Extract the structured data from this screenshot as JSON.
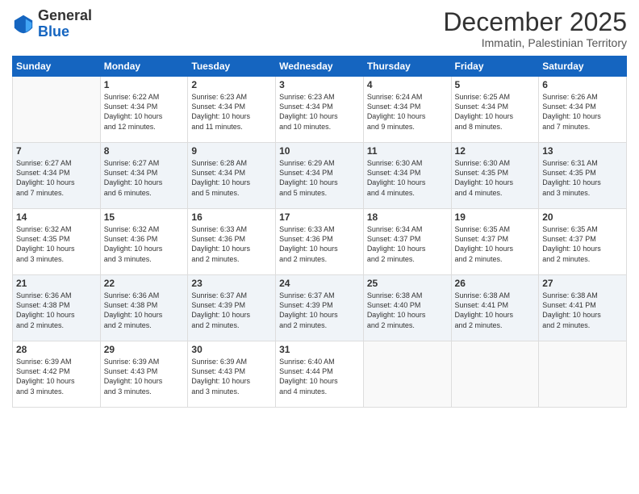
{
  "logo": {
    "general": "General",
    "blue": "Blue"
  },
  "header": {
    "month": "December 2025",
    "location": "Immatin, Palestinian Territory"
  },
  "days_of_week": [
    "Sunday",
    "Monday",
    "Tuesday",
    "Wednesday",
    "Thursday",
    "Friday",
    "Saturday"
  ],
  "weeks": [
    [
      {
        "day": "",
        "info": ""
      },
      {
        "day": "1",
        "info": "Sunrise: 6:22 AM\nSunset: 4:34 PM\nDaylight: 10 hours\nand 12 minutes."
      },
      {
        "day": "2",
        "info": "Sunrise: 6:23 AM\nSunset: 4:34 PM\nDaylight: 10 hours\nand 11 minutes."
      },
      {
        "day": "3",
        "info": "Sunrise: 6:23 AM\nSunset: 4:34 PM\nDaylight: 10 hours\nand 10 minutes."
      },
      {
        "day": "4",
        "info": "Sunrise: 6:24 AM\nSunset: 4:34 PM\nDaylight: 10 hours\nand 9 minutes."
      },
      {
        "day": "5",
        "info": "Sunrise: 6:25 AM\nSunset: 4:34 PM\nDaylight: 10 hours\nand 8 minutes."
      },
      {
        "day": "6",
        "info": "Sunrise: 6:26 AM\nSunset: 4:34 PM\nDaylight: 10 hours\nand 7 minutes."
      }
    ],
    [
      {
        "day": "7",
        "info": "Sunrise: 6:27 AM\nSunset: 4:34 PM\nDaylight: 10 hours\nand 7 minutes."
      },
      {
        "day": "8",
        "info": "Sunrise: 6:27 AM\nSunset: 4:34 PM\nDaylight: 10 hours\nand 6 minutes."
      },
      {
        "day": "9",
        "info": "Sunrise: 6:28 AM\nSunset: 4:34 PM\nDaylight: 10 hours\nand 5 minutes."
      },
      {
        "day": "10",
        "info": "Sunrise: 6:29 AM\nSunset: 4:34 PM\nDaylight: 10 hours\nand 5 minutes."
      },
      {
        "day": "11",
        "info": "Sunrise: 6:30 AM\nSunset: 4:34 PM\nDaylight: 10 hours\nand 4 minutes."
      },
      {
        "day": "12",
        "info": "Sunrise: 6:30 AM\nSunset: 4:35 PM\nDaylight: 10 hours\nand 4 minutes."
      },
      {
        "day": "13",
        "info": "Sunrise: 6:31 AM\nSunset: 4:35 PM\nDaylight: 10 hours\nand 3 minutes."
      }
    ],
    [
      {
        "day": "14",
        "info": "Sunrise: 6:32 AM\nSunset: 4:35 PM\nDaylight: 10 hours\nand 3 minutes."
      },
      {
        "day": "15",
        "info": "Sunrise: 6:32 AM\nSunset: 4:36 PM\nDaylight: 10 hours\nand 3 minutes."
      },
      {
        "day": "16",
        "info": "Sunrise: 6:33 AM\nSunset: 4:36 PM\nDaylight: 10 hours\nand 2 minutes."
      },
      {
        "day": "17",
        "info": "Sunrise: 6:33 AM\nSunset: 4:36 PM\nDaylight: 10 hours\nand 2 minutes."
      },
      {
        "day": "18",
        "info": "Sunrise: 6:34 AM\nSunset: 4:37 PM\nDaylight: 10 hours\nand 2 minutes."
      },
      {
        "day": "19",
        "info": "Sunrise: 6:35 AM\nSunset: 4:37 PM\nDaylight: 10 hours\nand 2 minutes."
      },
      {
        "day": "20",
        "info": "Sunrise: 6:35 AM\nSunset: 4:37 PM\nDaylight: 10 hours\nand 2 minutes."
      }
    ],
    [
      {
        "day": "21",
        "info": "Sunrise: 6:36 AM\nSunset: 4:38 PM\nDaylight: 10 hours\nand 2 minutes."
      },
      {
        "day": "22",
        "info": "Sunrise: 6:36 AM\nSunset: 4:38 PM\nDaylight: 10 hours\nand 2 minutes."
      },
      {
        "day": "23",
        "info": "Sunrise: 6:37 AM\nSunset: 4:39 PM\nDaylight: 10 hours\nand 2 minutes."
      },
      {
        "day": "24",
        "info": "Sunrise: 6:37 AM\nSunset: 4:39 PM\nDaylight: 10 hours\nand 2 minutes."
      },
      {
        "day": "25",
        "info": "Sunrise: 6:38 AM\nSunset: 4:40 PM\nDaylight: 10 hours\nand 2 minutes."
      },
      {
        "day": "26",
        "info": "Sunrise: 6:38 AM\nSunset: 4:41 PM\nDaylight: 10 hours\nand 2 minutes."
      },
      {
        "day": "27",
        "info": "Sunrise: 6:38 AM\nSunset: 4:41 PM\nDaylight: 10 hours\nand 2 minutes."
      }
    ],
    [
      {
        "day": "28",
        "info": "Sunrise: 6:39 AM\nSunset: 4:42 PM\nDaylight: 10 hours\nand 3 minutes."
      },
      {
        "day": "29",
        "info": "Sunrise: 6:39 AM\nSunset: 4:43 PM\nDaylight: 10 hours\nand 3 minutes."
      },
      {
        "day": "30",
        "info": "Sunrise: 6:39 AM\nSunset: 4:43 PM\nDaylight: 10 hours\nand 3 minutes."
      },
      {
        "day": "31",
        "info": "Sunrise: 6:40 AM\nSunset: 4:44 PM\nDaylight: 10 hours\nand 4 minutes."
      },
      {
        "day": "",
        "info": ""
      },
      {
        "day": "",
        "info": ""
      },
      {
        "day": "",
        "info": ""
      }
    ]
  ]
}
